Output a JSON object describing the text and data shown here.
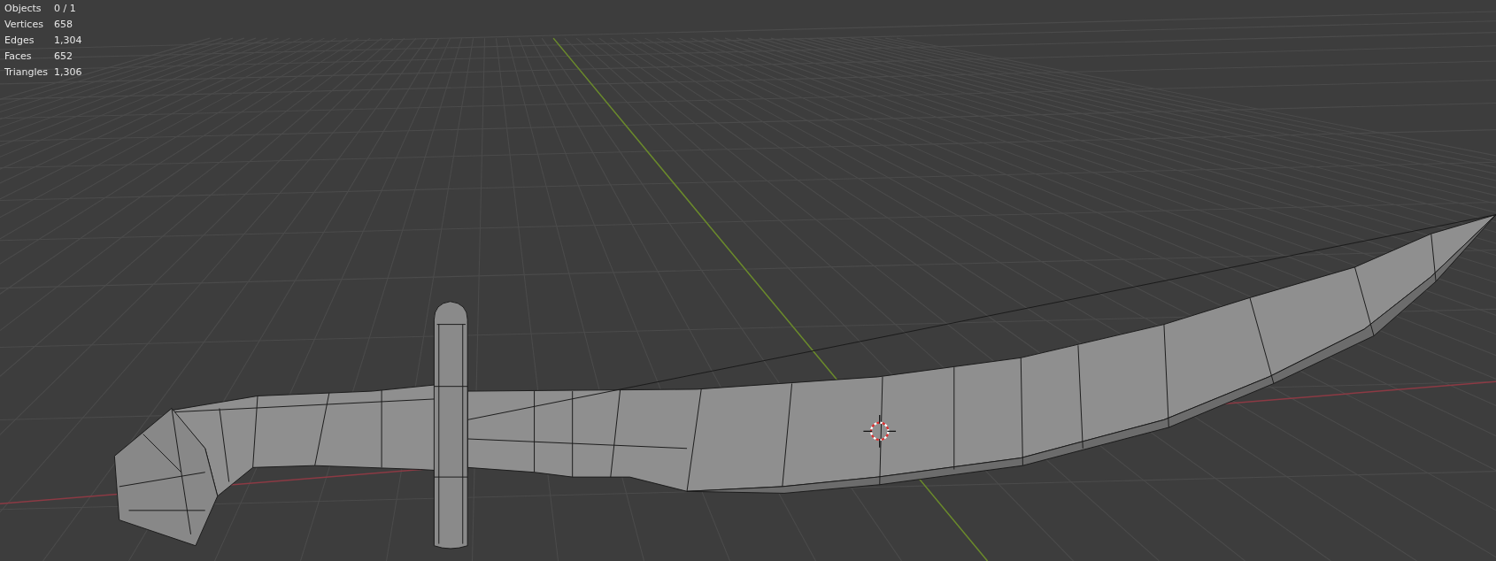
{
  "viewport": {
    "stats": [
      {
        "label": "Objects",
        "value": "0 / 1"
      },
      {
        "label": "Vertices",
        "value": "658"
      },
      {
        "label": "Edges",
        "value": "1,304"
      },
      {
        "label": "Faces",
        "value": "652"
      },
      {
        "label": "Triangles",
        "value": "1,306"
      }
    ]
  }
}
